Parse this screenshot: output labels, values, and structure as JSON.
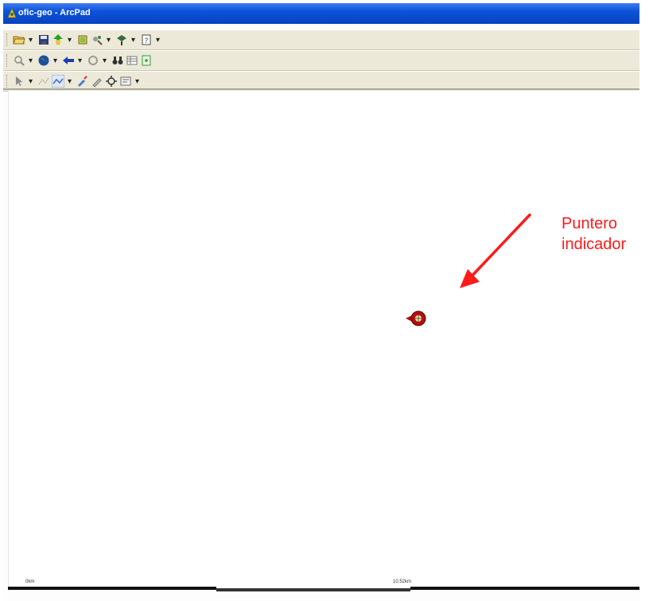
{
  "window": {
    "title": "ofic-geo - ArcPad"
  },
  "toolbars": {
    "row1": [
      {
        "icon": "open-folder-icon",
        "color": "#c9a23c"
      },
      {
        "icon": "save-icon",
        "color": "#2a3a8a"
      },
      {
        "icon": "add-layer-icon",
        "color": "#2aa02a"
      },
      {
        "icon": "layers-icon",
        "color": "#d6c25a"
      },
      {
        "icon": "table-of-contents-icon",
        "color": "#6b6b6b"
      },
      {
        "icon": "gps-icon",
        "color": "#3a6a3a"
      },
      {
        "icon": "help-icon",
        "color": "#4a4a4a"
      }
    ],
    "row2": [
      {
        "icon": "zoom-icon",
        "color": "#8a8a8a"
      },
      {
        "icon": "globe-icon",
        "color": "#1e4ea0"
      },
      {
        "icon": "back-arrow-icon",
        "color": "#1a3ab0"
      },
      {
        "icon": "refresh-icon",
        "color": "#9a9a9a"
      },
      {
        "icon": "find-binoculars-icon",
        "color": "#333333"
      },
      {
        "icon": "table-icon",
        "color": "#777777"
      },
      {
        "icon": "export-icon",
        "color": "#3a9a3a"
      }
    ],
    "row3": [
      {
        "icon": "select-cursor-icon",
        "color": "#8a8a8a"
      },
      {
        "icon": "point-tool-icon",
        "color": "#9a9a9a"
      },
      {
        "icon": "polyline-icon",
        "color": "#3a6acf"
      },
      {
        "icon": "edit-vertex-icon",
        "color": "#4a7ad0"
      },
      {
        "icon": "pen-icon",
        "color": "#7a7a7a"
      },
      {
        "icon": "gps-position-icon",
        "color": "#3a3a3a"
      },
      {
        "icon": "properties-icon",
        "color": "#6a6a6a"
      }
    ]
  },
  "annotation": {
    "line1": "Puntero",
    "line2": "indicador",
    "color": "#ff1a1a"
  },
  "scale": {
    "left_label": "0km",
    "mid_label": "10.52km"
  }
}
